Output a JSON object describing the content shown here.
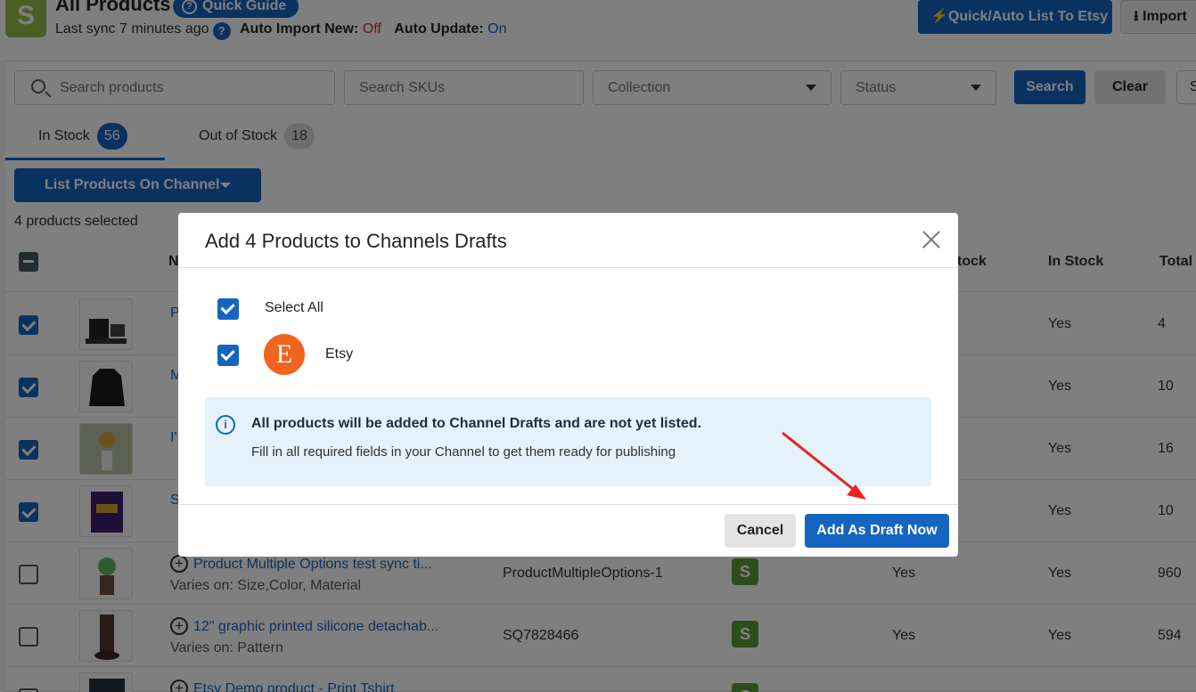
{
  "header": {
    "logo_letter": "S",
    "title": "All Products",
    "quick_guide": "Quick Guide",
    "sync_text": "Last sync 7 minutes ago",
    "auto_import_label": "Auto Import New:",
    "auto_import_value": "Off",
    "auto_update_label": "Auto Update:",
    "auto_update_value": "On",
    "etsy_button": "Quick/Auto List To Etsy",
    "import_button": "Import",
    "icons": [
      "shopify-logo-icon",
      "help-icon",
      "lightning-icon",
      "download-icon"
    ]
  },
  "filters": {
    "search_placeholder": "Search products",
    "sku_placeholder": "Search SKUs",
    "collection_placeholder": "Collection",
    "status_placeholder": "Status",
    "search_button": "Search",
    "clear_button": "Clear",
    "extra_button": "S"
  },
  "tabs": [
    {
      "label": "In Stock",
      "count": "56",
      "active": true
    },
    {
      "label": "Out of Stock",
      "count": "18",
      "active": false
    }
  ],
  "actions": {
    "list_button": "List Products On Channel",
    "selected_text": "4 products selected"
  },
  "table": {
    "headers": {
      "name": "N",
      "stock": "tock",
      "in_stock": "In Stock",
      "total": "Total"
    },
    "rows": [
      {
        "checked": true,
        "name": "P",
        "variants": "",
        "sku": "",
        "channel_stock": "",
        "in_stock": "Yes",
        "total": "4"
      },
      {
        "checked": true,
        "name": "M",
        "variants": "",
        "sku": "",
        "channel_stock": "",
        "in_stock": "Yes",
        "total": "10"
      },
      {
        "checked": true,
        "name": "I'",
        "variants": "",
        "sku": "",
        "channel_stock": "",
        "in_stock": "Yes",
        "total": "16"
      },
      {
        "checked": true,
        "name": "S",
        "variants": "",
        "sku": "",
        "channel_stock": "",
        "in_stock": "Yes",
        "total": "10"
      },
      {
        "checked": false,
        "name": "Product Multiple Options test sync ti...",
        "variants": "Varies on: Size,Color, Material",
        "sku": "ProductMultipleOptions-1",
        "channel_stock": "Yes",
        "in_stock": "Yes",
        "total": "960"
      },
      {
        "checked": false,
        "name": "12\" graphic printed silicone detachab...",
        "variants": "Varies on: Pattern",
        "sku": "SQ7828466",
        "channel_stock": "Yes",
        "in_stock": "Yes",
        "total": "594"
      },
      {
        "checked": false,
        "name": "Etsy Demo product - Print Tshirt",
        "variants": "",
        "sku": "",
        "channel_stock": "",
        "in_stock": "",
        "total": ""
      }
    ]
  },
  "modal": {
    "title": "Add 4 Products to Channels Drafts",
    "select_all": "Select All",
    "etsy_letter": "E",
    "etsy_label": "Etsy",
    "info_heading": "All products will be added to Channel Drafts and are not yet listed.",
    "info_text": "Fill in all required fields in your Channel to get them ready for publishing",
    "cancel": "Cancel",
    "confirm": "Add As Draft Now",
    "colors": {
      "primary": "#1565c0",
      "etsy": "#f1641e",
      "info_bg": "#e6f2fb",
      "annotation": "#e8221b"
    }
  }
}
